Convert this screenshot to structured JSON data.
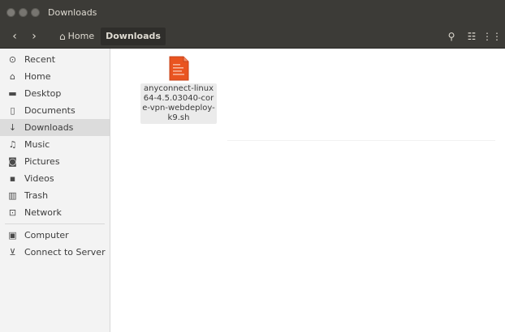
{
  "window": {
    "title": "Downloads",
    "buttons": {
      "close": "✕",
      "minimize": "–",
      "maximize": "□"
    }
  },
  "toolbar": {
    "back_icon": "‹",
    "forward_icon": "›",
    "breadcrumb": {
      "home_label": "Home",
      "current_label": "Downloads"
    },
    "search_icon": "⚲",
    "list_view_icon": "☷",
    "grid_view_icon": "⋮⋮"
  },
  "sidebar": {
    "items": [
      {
        "label": "Recent",
        "icon": "clock-icon",
        "glyph": "⊙"
      },
      {
        "label": "Home",
        "icon": "home-icon",
        "glyph": "⌂"
      },
      {
        "label": "Desktop",
        "icon": "folder-icon",
        "glyph": "▬"
      },
      {
        "label": "Documents",
        "icon": "document-icon",
        "glyph": "▯"
      },
      {
        "label": "Downloads",
        "icon": "download-icon",
        "glyph": "↓",
        "active": true
      },
      {
        "label": "Music",
        "icon": "music-icon",
        "glyph": "♫"
      },
      {
        "label": "Pictures",
        "icon": "camera-icon",
        "glyph": "◙"
      },
      {
        "label": "Videos",
        "icon": "video-icon",
        "glyph": "▪"
      },
      {
        "label": "Trash",
        "icon": "trash-icon",
        "glyph": "▥"
      },
      {
        "label": "Network",
        "icon": "network-icon",
        "glyph": "⊡"
      }
    ],
    "devices": [
      {
        "label": "Computer",
        "icon": "computer-icon",
        "glyph": "▣"
      },
      {
        "label": "Connect to Server",
        "icon": "server-icon",
        "glyph": "⊻"
      }
    ]
  },
  "files": [
    {
      "name": "anyconnect-linux64-4.5.03040-core-vpn-webdeploy-k9.sh",
      "icon": "shell-script-icon",
      "color": "#e95420"
    }
  ],
  "colors": {
    "titlebar": "#3c3b37",
    "sidebar_active": "#dcdcdc",
    "file_icon": "#e95420"
  }
}
